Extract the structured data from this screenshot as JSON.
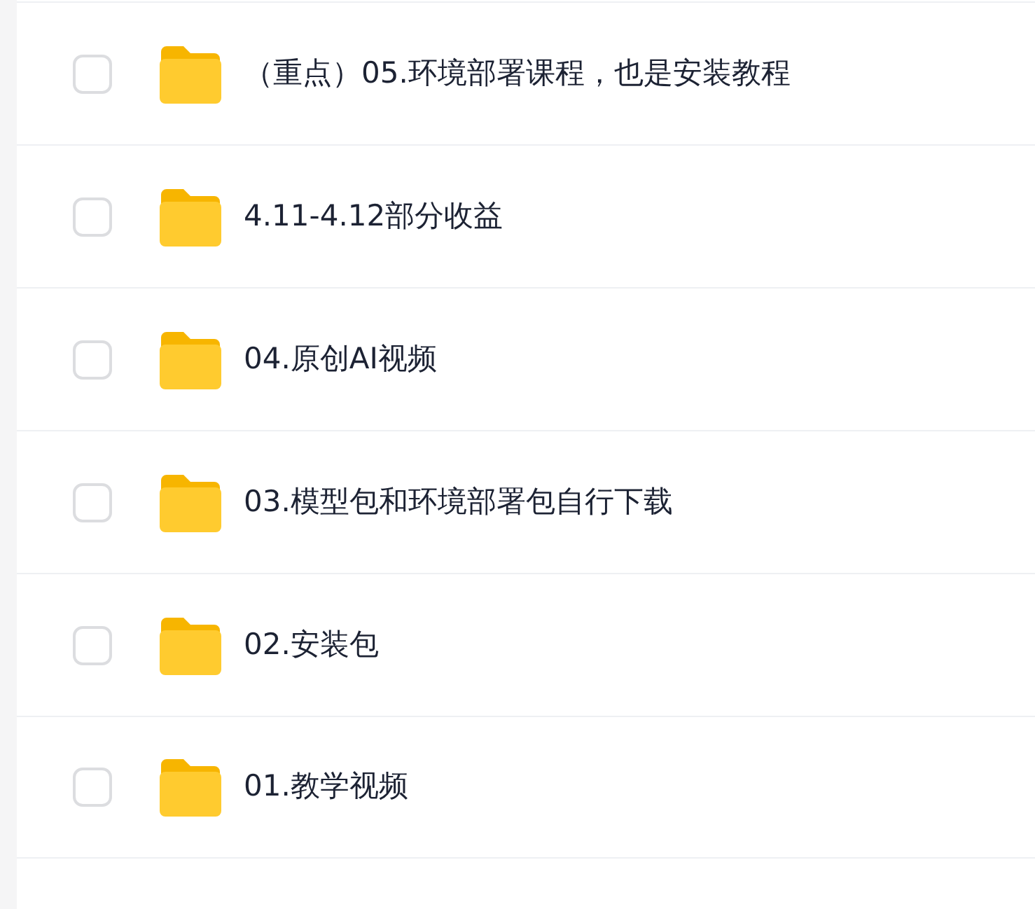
{
  "files": [
    {
      "name": "（重点）05.环境部署课程，也是安装教程",
      "checked": false
    },
    {
      "name": "4.11-4.12部分收益",
      "checked": false
    },
    {
      "name": "04.原创AI视频",
      "checked": false
    },
    {
      "name": "03.模型包和环境部署包自行下载",
      "checked": false
    },
    {
      "name": "02.安装包",
      "checked": false
    },
    {
      "name": "01.教学视频",
      "checked": false
    }
  ]
}
